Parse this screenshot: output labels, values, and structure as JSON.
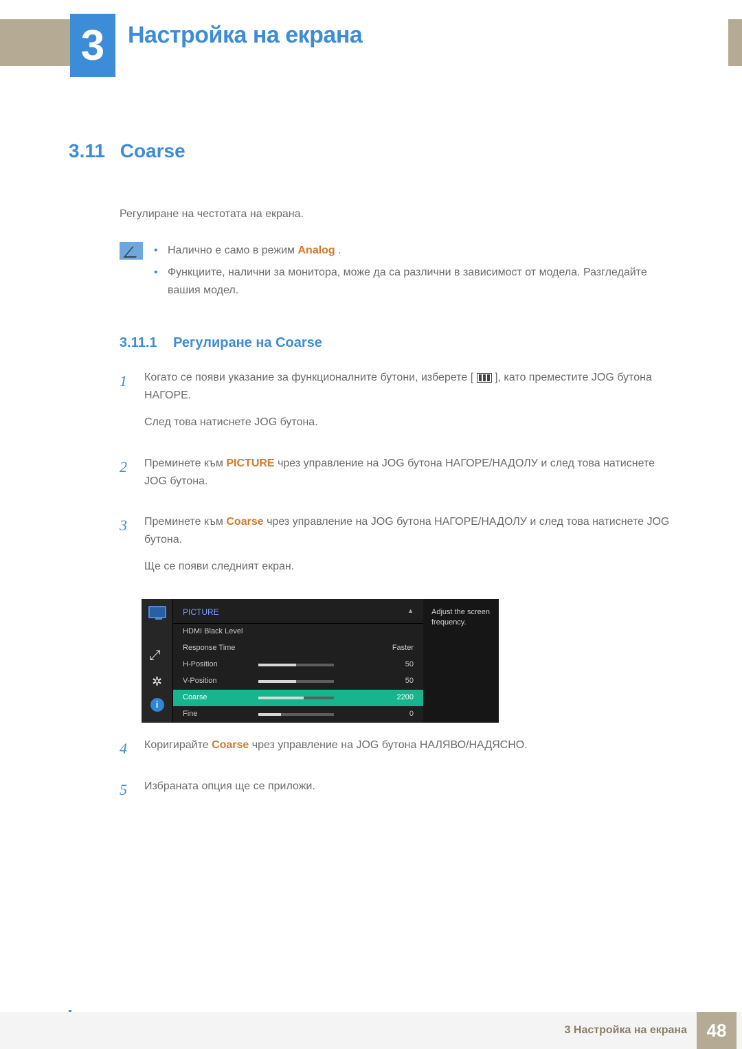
{
  "chapter": {
    "number": "3",
    "title": "Настройка на екрана"
  },
  "section": {
    "number": "3.11",
    "title": "Coarse"
  },
  "intro": "Регулиране на честотата на екрана.",
  "notes": {
    "items": [
      {
        "prefix": "Налично е само в режим ",
        "highlight": "Analog",
        "suffix": "."
      },
      {
        "text": "Функциите, налични за монитора, може да са различни в зависимост от модела. Разгледайте вашия модел."
      }
    ]
  },
  "subsection": {
    "number": "3.11.1",
    "title": "Регулиране на Coarse"
  },
  "steps": [
    {
      "n": "1",
      "pre": "Когато се появи указание за функционалните бутони, изберете [",
      "post": "], като преместите JOG бутона НАГОРЕ.",
      "line2": "След това натиснете JOG бутона."
    },
    {
      "n": "2",
      "pre": "Преминете към ",
      "hl": "PICTURE",
      "post": " чрез управление на JOG бутона НАГОРЕ/НАДОЛУ и след това натиснете JOG бутона."
    },
    {
      "n": "3",
      "pre": "Преминете към ",
      "hl": "Coarse",
      "post": " чрез управление на JOG бутона НАГОРЕ/НАДОЛУ и след това натиснете JOG бутона.",
      "line2": "Ще се появи следният екран."
    },
    {
      "n": "4",
      "pre": "Коригирайте ",
      "hl": "Coarse",
      "post": " чрез управление на JOG бутона НАЛЯВО/НАДЯСНО."
    },
    {
      "n": "5",
      "text": "Избраната опция ще се приложи."
    }
  ],
  "osd": {
    "title": "PICTURE",
    "tooltip": "Adjust the screen frequency.",
    "rows": [
      {
        "label": "HDMI Black Level",
        "value": "",
        "fill": 0,
        "showbar": false
      },
      {
        "label": "Response Time",
        "value": "Faster",
        "fill": 0,
        "showbar": false
      },
      {
        "label": "H-Position",
        "value": "50",
        "fill": 50,
        "showbar": true
      },
      {
        "label": "V-Position",
        "value": "50",
        "fill": 50,
        "showbar": true
      },
      {
        "label": "Coarse",
        "value": "2200",
        "fill": 60,
        "showbar": true,
        "selected": true
      },
      {
        "label": "Fine",
        "value": "0",
        "fill": 30,
        "showbar": true
      }
    ]
  },
  "footer": {
    "label": "3 Настройка на екрана",
    "page": "48"
  }
}
